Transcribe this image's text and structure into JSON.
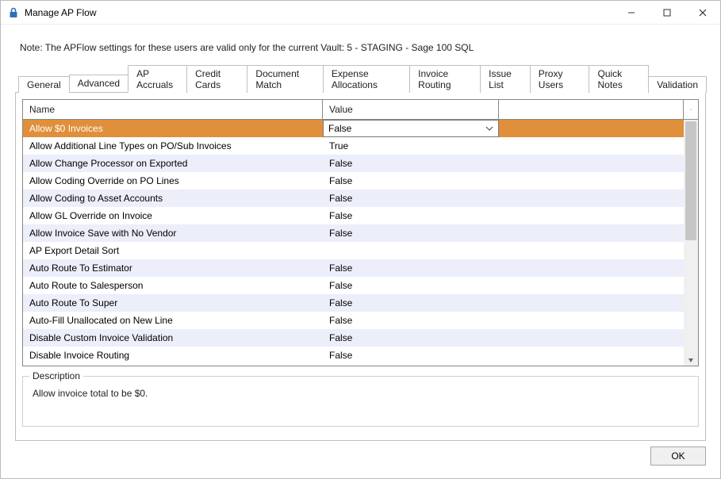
{
  "window": {
    "title": "Manage AP Flow"
  },
  "note": "Note:  The APFlow settings for these users are valid only for the current Vault: 5 - STAGING - Sage 100 SQL",
  "tabs": [
    {
      "label": "General",
      "active": false
    },
    {
      "label": "Advanced",
      "active": true
    },
    {
      "label": "AP Accruals",
      "active": false
    },
    {
      "label": "Credit Cards",
      "active": false
    },
    {
      "label": "Document Match",
      "active": false
    },
    {
      "label": "Expense Allocations",
      "active": false
    },
    {
      "label": "Invoice Routing",
      "active": false
    },
    {
      "label": "Issue List",
      "active": false
    },
    {
      "label": "Proxy Users",
      "active": false
    },
    {
      "label": "Quick Notes",
      "active": false
    },
    {
      "label": "Validation",
      "active": false
    }
  ],
  "grid": {
    "columns": {
      "name": "Name",
      "value": "Value"
    },
    "rows": [
      {
        "name": "Allow $0 Invoices",
        "value": "False",
        "selected": true
      },
      {
        "name": "Allow Additional Line Types on PO/Sub Invoices",
        "value": "True"
      },
      {
        "name": "Allow Change Processor on Exported",
        "value": "False"
      },
      {
        "name": "Allow Coding Override on PO Lines",
        "value": "False"
      },
      {
        "name": "Allow Coding to Asset Accounts",
        "value": "False"
      },
      {
        "name": "Allow GL Override on Invoice",
        "value": "False"
      },
      {
        "name": "Allow Invoice Save with No Vendor",
        "value": "False"
      },
      {
        "name": "AP Export Detail Sort",
        "value": ""
      },
      {
        "name": "Auto Route To Estimator",
        "value": "False"
      },
      {
        "name": "Auto Route to Salesperson",
        "value": "False"
      },
      {
        "name": "Auto Route To Super",
        "value": "False"
      },
      {
        "name": "Auto-Fill Unallocated on New Line",
        "value": "False"
      },
      {
        "name": "Disable Custom Invoice Validation",
        "value": "False"
      },
      {
        "name": "Disable Invoice Routing",
        "value": "False"
      }
    ]
  },
  "description": {
    "legend": "Description",
    "text": "Allow invoice total to be $0."
  },
  "buttons": {
    "ok": "OK"
  }
}
